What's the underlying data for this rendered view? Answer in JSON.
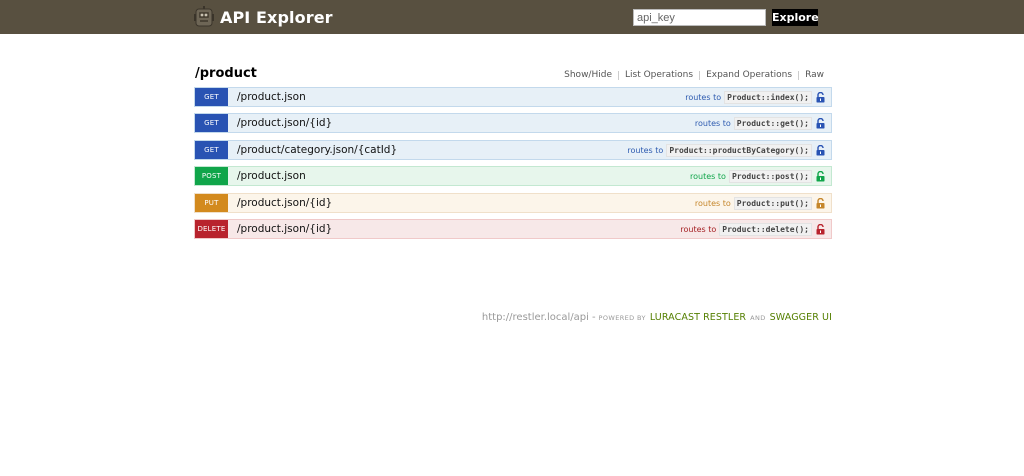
{
  "header": {
    "title": "API Explorer",
    "api_key_placeholder": "api_key",
    "explore_label": "Explore"
  },
  "resource": {
    "name": "/product",
    "options": [
      "Show/Hide",
      "List Operations",
      "Expand Operations",
      "Raw"
    ]
  },
  "operations": [
    {
      "method": "GET",
      "path": "/product.json",
      "routes_to": "routes to",
      "handler": "Product::index();"
    },
    {
      "method": "GET",
      "path": "/product.json/{id}",
      "routes_to": "routes to",
      "handler": "Product::get();"
    },
    {
      "method": "GET",
      "path": "/product/category.json/{catId}",
      "routes_to": "routes to",
      "handler": "Product::productByCategory();"
    },
    {
      "method": "POST",
      "path": "/product.json",
      "routes_to": "routes to",
      "handler": "Product::post();"
    },
    {
      "method": "PUT",
      "path": "/product.json/{id}",
      "routes_to": "routes to",
      "handler": "Product::put();"
    },
    {
      "method": "DELETE",
      "path": "/product.json/{id}",
      "routes_to": "routes to",
      "handler": "Product::delete();"
    }
  ],
  "footer": {
    "base_url": "http://restler.local/api",
    "dash": "-",
    "powered_by": "POWERED BY",
    "link1": "LURACAST RESTLER",
    "and": "AND",
    "link2": "SWAGGER UI"
  },
  "colors": {
    "header_bg": "#585040",
    "get": "#2953b3",
    "post": "#10a54a",
    "put": "#d38a1e",
    "delete": "#b8232d",
    "footer_link": "#547f00"
  },
  "icons": {
    "logo": "robot-logo-icon",
    "lock": "unlocked-padlock-icon"
  }
}
